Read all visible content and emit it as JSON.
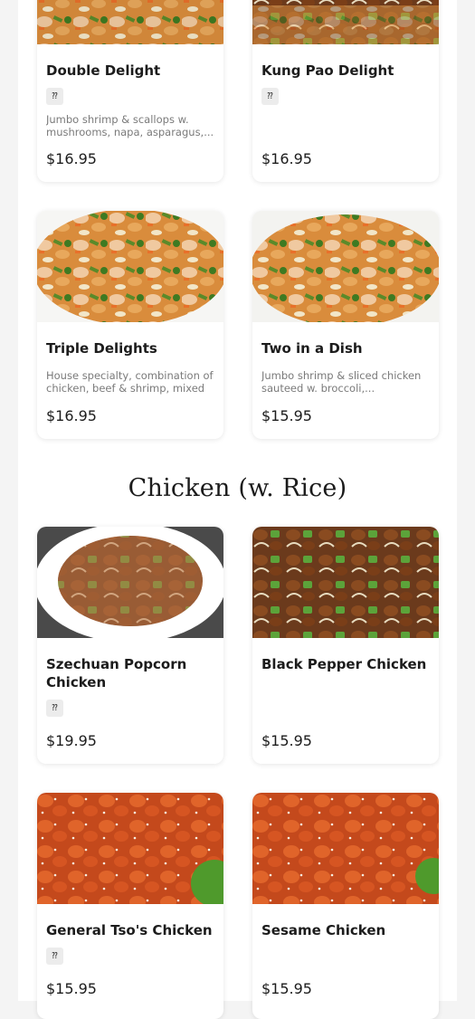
{
  "seafood_items": [
    {
      "name": "Double Delight",
      "badge": "⁇",
      "description": "Jumbo shrimp & scallops w. mushrooms, napa, asparagus,...",
      "price": "$16.95"
    },
    {
      "name": "Kung Pao Delight",
      "badge": "⁇",
      "description": "",
      "price": "$16.95"
    },
    {
      "name": "Triple Delights",
      "description": "House specialty, combination of chicken, beef & shrimp, mixed ...",
      "price": "$16.95"
    },
    {
      "name": "Two in a Dish",
      "description": "Jumbo shrimp & sliced chicken sauteed w. broccoli,...",
      "price": "$15.95"
    }
  ],
  "chicken_section": {
    "title": "Chicken (w. Rice)",
    "items": [
      {
        "name": "Szechuan Popcorn Chicken",
        "badge": "⁇",
        "price": "$19.95"
      },
      {
        "name": "Black Pepper Chicken",
        "price": "$15.95"
      },
      {
        "name": "General Tso's Chicken",
        "badge": "⁇",
        "price": "$15.95"
      },
      {
        "name": "Sesame Chicken",
        "price": "$15.95"
      }
    ]
  },
  "icons": {
    "spicy_badge": "spicy-icon"
  },
  "colors": {
    "background": "#f4f4f4",
    "card": "#ffffff",
    "badge": "#ececec",
    "description": "#7a7a7a"
  }
}
